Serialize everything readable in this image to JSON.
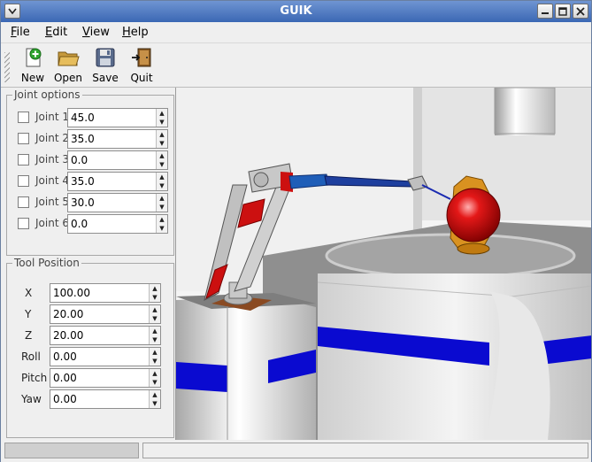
{
  "window": {
    "title": "GUIK"
  },
  "menu": [
    {
      "label": "File",
      "accel": "F",
      "rest": "ile"
    },
    {
      "label": "Edit",
      "accel": "E",
      "rest": "dit"
    },
    {
      "label": "View",
      "accel": "V",
      "rest": "iew"
    },
    {
      "label": "Help",
      "accel": "H",
      "rest": "elp"
    }
  ],
  "toolbar": {
    "new_label": "New",
    "open_label": "Open",
    "save_label": "Save",
    "quit_label": "Quit"
  },
  "joint_options": {
    "title": "Joint options",
    "joints": [
      {
        "label": "Joint 1",
        "value": "45.0",
        "checked": false
      },
      {
        "label": "Joint 2",
        "value": "35.0",
        "checked": false
      },
      {
        "label": "Joint 3",
        "value": "0.0",
        "checked": false
      },
      {
        "label": "Joint 4",
        "value": "35.0",
        "checked": false
      },
      {
        "label": "Joint 5",
        "value": "30.0",
        "checked": false
      },
      {
        "label": "Joint 6",
        "value": "0.0",
        "checked": false
      }
    ]
  },
  "tool_position": {
    "title": "Tool Position",
    "fields": [
      {
        "label": "X",
        "value": "100.00"
      },
      {
        "label": "Y",
        "value": "20.00"
      },
      {
        "label": "Z",
        "value": "20.00"
      },
      {
        "label": "Roll",
        "value": "0.00"
      },
      {
        "label": "Pitch",
        "value": "0.00"
      },
      {
        "label": "Yaw",
        "value": "0.00"
      }
    ]
  },
  "icons": {
    "new": "new-document-icon",
    "open": "folder-open-icon",
    "save": "floppy-disk-icon",
    "quit": "exit-door-icon"
  },
  "colors": {
    "titlebar": "#4a76c0",
    "robot_arm": "#c9c9c9",
    "robot_red": "#cc1010",
    "tool_blue": "#1e3f9e",
    "stripe_blue": "#0a0ad0"
  }
}
